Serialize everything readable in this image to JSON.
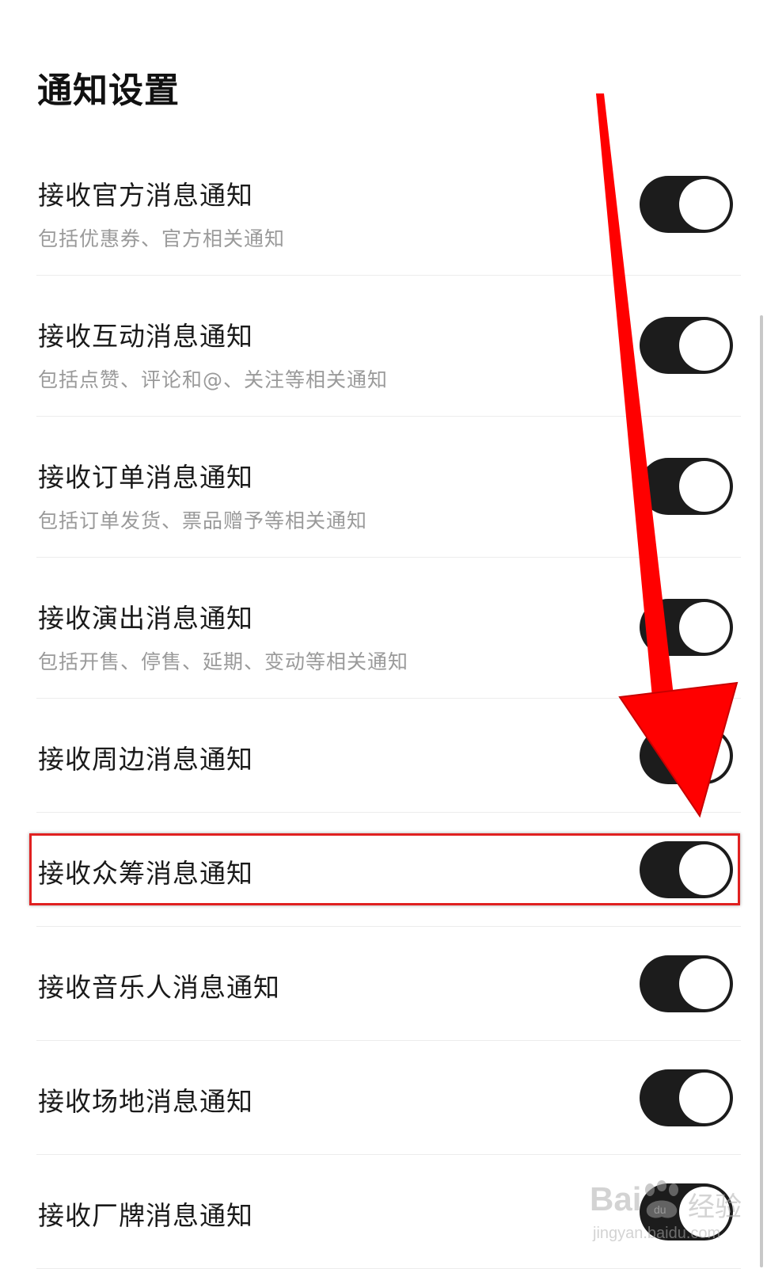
{
  "page": {
    "title": "通知设置"
  },
  "settings": [
    {
      "label": "接收官方消息通知",
      "description": "包括优惠券、官方相关通知",
      "enabled": true
    },
    {
      "label": "接收互动消息通知",
      "description": "包括点赞、评论和@、关注等相关通知",
      "enabled": true
    },
    {
      "label": "接收订单消息通知",
      "description": "包括订单发货、票品赠予等相关通知",
      "enabled": true
    },
    {
      "label": "接收演出消息通知",
      "description": "包括开售、停售、延期、变动等相关通知",
      "enabled": true
    },
    {
      "label": "接收周边消息通知",
      "enabled": true
    },
    {
      "label": "接收众筹消息通知",
      "enabled": true
    },
    {
      "label": "接收音乐人消息通知",
      "enabled": true
    },
    {
      "label": "接收场地消息通知",
      "enabled": true
    },
    {
      "label": "接收厂牌消息通知",
      "enabled": true
    }
  ],
  "annotation": {
    "highlight_color": "#e02020",
    "arrow_color": "#ff0000"
  },
  "watermark": {
    "brand": "Bai",
    "suffix": "经验",
    "site": "jingyan.baidu.com"
  },
  "colors": {
    "toggle_on": "#1c1c1c",
    "knob": "#ffffff",
    "subtitle": "#9a9a9a"
  }
}
